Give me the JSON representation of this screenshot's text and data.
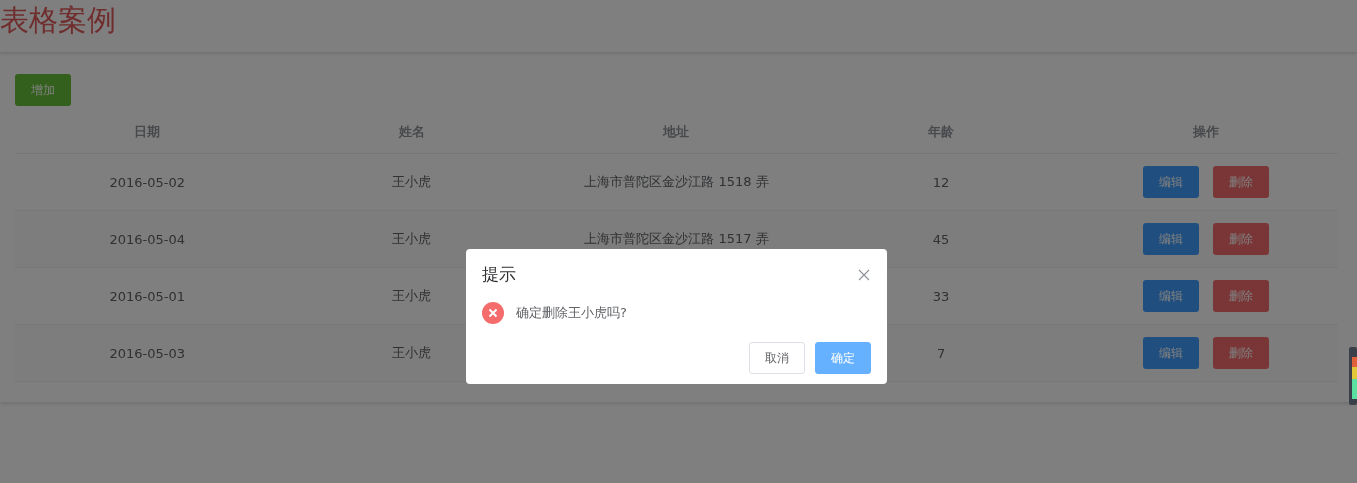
{
  "page_title": "表格案例",
  "add_button": "增加",
  "table": {
    "columns": [
      "日期",
      "姓名",
      "地址",
      "年龄",
      "操作"
    ],
    "rows": [
      {
        "date": "2016-05-02",
        "name": "王小虎",
        "address": "上海市普陀区金沙江路 1518 弄",
        "age": "12",
        "actions": [
          "编辑",
          "删除"
        ]
      },
      {
        "date": "2016-05-04",
        "name": "王小虎",
        "address": "上海市普陀区金沙江路 1517 弄",
        "age": "45",
        "actions": [
          "编辑",
          "删除"
        ]
      },
      {
        "date": "2016-05-01",
        "name": "王小虎",
        "age": "33",
        "actions": [
          "编辑",
          "删除"
        ]
      },
      {
        "date": "2016-05-03",
        "name": "王小虎",
        "age": "7",
        "actions": [
          "编辑",
          "删除"
        ]
      }
    ]
  },
  "dialog": {
    "title": "提示",
    "message": "确定删除王小虎吗?",
    "buttons": [
      {
        "label": "取消",
        "kind": "plain"
      },
      {
        "label": "确定",
        "kind": "primary"
      }
    ]
  }
}
